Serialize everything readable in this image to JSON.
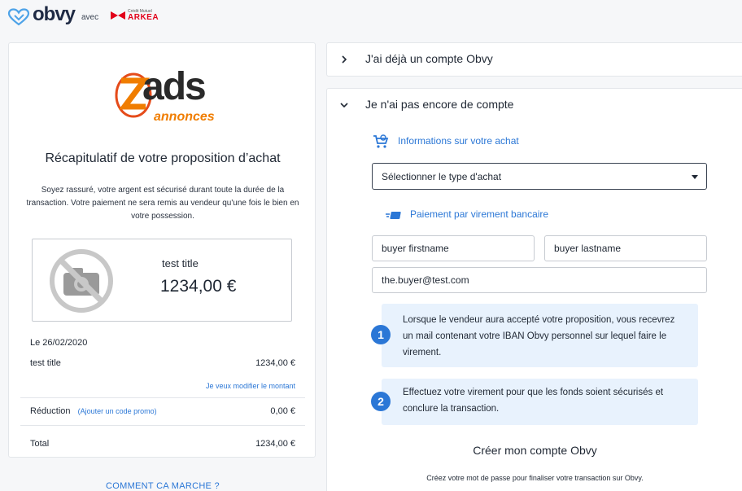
{
  "header": {
    "logo_text": "obvy",
    "avec": "avec",
    "partner_small": "Crédit Mutuel",
    "partner_name": "ARKEA"
  },
  "recap": {
    "merchant_logo_word": "ads",
    "merchant_logo_sub": "annonces",
    "title": "Récapitulatif de votre proposition d’achat",
    "reassurance": "Soyez rassuré, votre argent est sécurisé durant toute la durée de la transaction. Votre paiement ne sera remis au vendeur qu'une fois le bien en votre possession.",
    "product": {
      "title": "test title",
      "price": "1234,00 €"
    },
    "date": "Le 26/02/2020",
    "item_label": "test title",
    "item_amount": "1234,00 €",
    "modify_link": "Je veux modifier le montant",
    "discount_label": "Réduction",
    "promo_link": "(Ajouter un code promo)",
    "discount_amount": "0,00 €",
    "total_label": "Total",
    "total_amount": "1234,00 €"
  },
  "how_it_works": "COMMENT CA MARCHE ?",
  "accordion": {
    "existing_account": "J'ai déjà un compte Obvy",
    "no_account": "Je n'ai pas encore de compte"
  },
  "purchase_info": {
    "label": "Informations sur votre achat",
    "select_value": "Sélectionner le type d'achat"
  },
  "payment": {
    "label": "Paiement par virement bancaire",
    "firstname": "buyer firstname",
    "lastname": "buyer lastname",
    "email": "the.buyer@test.com"
  },
  "steps": [
    {
      "number": "1",
      "text": "Lorsque le vendeur aura accepté votre proposition, vous recevrez un mail contenant votre IBAN Obvy personnel sur lequel faire le virement."
    },
    {
      "number": "2",
      "text": "Effectuez votre virement pour que les fonds soient sécurisés et conclure la transaction."
    }
  ],
  "create_account": {
    "title": "Créer mon compte Obvy",
    "subtitle": "Créez votre mot de passe pour finaliser votre transaction sur Obvy."
  },
  "colors": {
    "accent": "#2b77d6",
    "step_bg": "#e8f2fd",
    "brand_red": "#e2001a",
    "merchant_orange": "#f07d00"
  },
  "icons": [
    "heart-logo-icon",
    "arkea-mark-icon",
    "no-photo-icon",
    "chevron-right-icon",
    "chevron-down-icon",
    "shopping-cart-icon",
    "bank-transfer-icon"
  ]
}
